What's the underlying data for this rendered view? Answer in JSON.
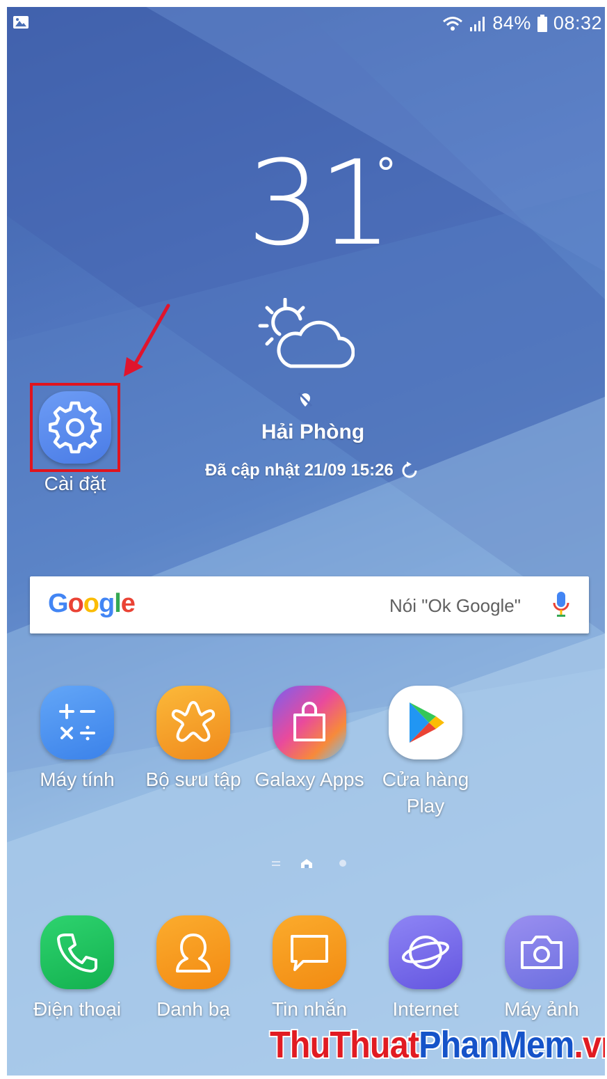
{
  "status_bar": {
    "left_icon": "image-icon",
    "battery": "84%",
    "time": "08:32"
  },
  "weather": {
    "temperature": "31",
    "degree": "°",
    "icon": "partly-cloudy-icon",
    "location_icon": "location-off-icon",
    "city": "Hải Phòng",
    "updated": "Đã cập nhật 21/09 15:26",
    "refresh_icon": "refresh-icon"
  },
  "settings_app": {
    "label": "Cài đặt",
    "icon": "gear-icon"
  },
  "search": {
    "logo": "Google",
    "hint": "Nói \"Ok Google\"",
    "mic_icon": "mic-icon"
  },
  "apps_row": [
    {
      "label": "Máy tính",
      "icon": "calculator-icon",
      "color": "#4d8ef0"
    },
    {
      "label": "Bộ sưu tập",
      "icon": "gallery-icon",
      "color": "#f5a623"
    },
    {
      "label": "Galaxy Apps",
      "icon": "galaxy-apps-icon",
      "color": "#e84d8a"
    },
    {
      "label": "Cửa hàng\nPlay",
      "icon": "play-store-icon",
      "color": "#ffffff"
    }
  ],
  "dock": [
    {
      "label": "Điện thoại",
      "icon": "phone-icon",
      "color": "#1dc15b"
    },
    {
      "label": "Danh bạ",
      "icon": "contacts-icon",
      "color": "#f79a1d"
    },
    {
      "label": "Tin nhắn",
      "icon": "messages-icon",
      "color": "#f5981a"
    },
    {
      "label": "Internet",
      "icon": "internet-icon",
      "color": "#7b6ef0"
    },
    {
      "label": "Máy ảnh",
      "icon": "camera-icon",
      "color": "#7d7fe8"
    }
  ],
  "watermark": {
    "part1": "ThuThuat",
    "part2": "PhanMem",
    "part3": ".vn"
  },
  "colors": {
    "highlight": "#e0141e",
    "arrow": "#e0142d"
  }
}
